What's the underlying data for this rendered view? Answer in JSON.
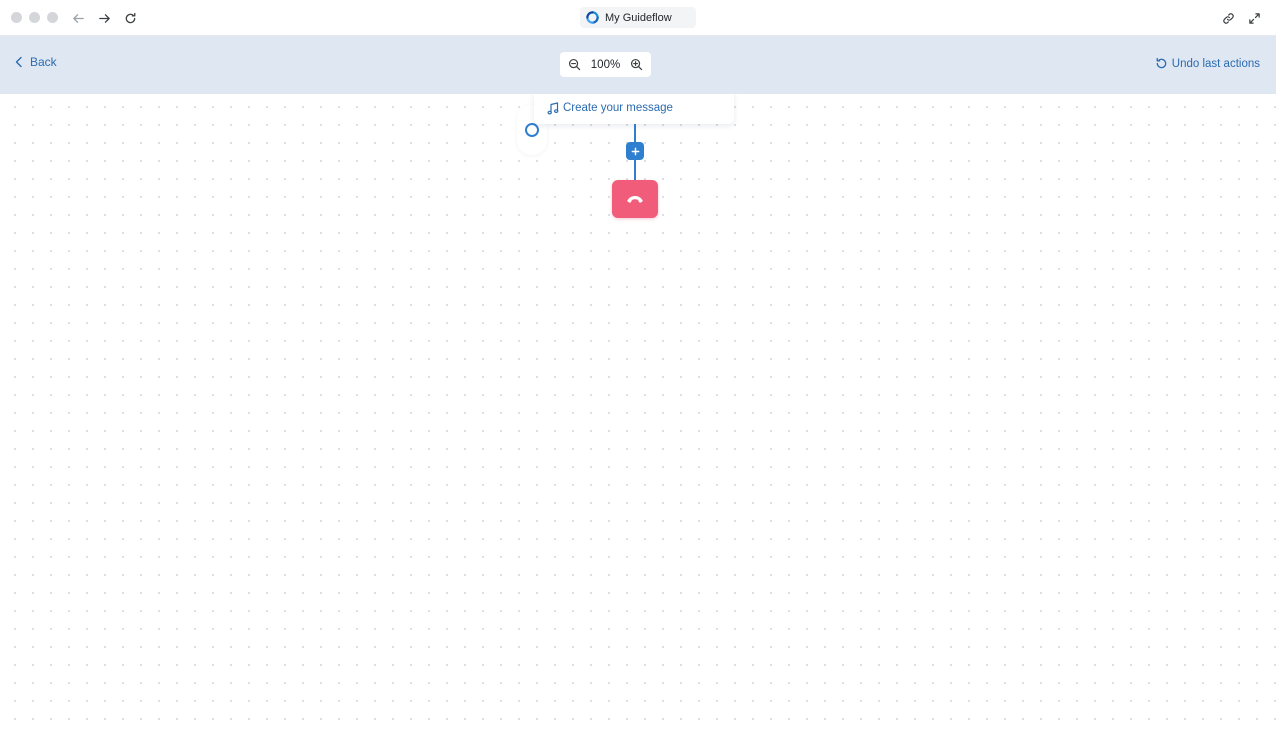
{
  "browser": {
    "tab_title": "My Guideflow",
    "icons": {
      "back": "arrow-left-icon",
      "forward": "arrow-right-icon",
      "reload": "reload-icon",
      "link": "link-icon",
      "expand": "expand-icon"
    }
  },
  "toolbar": {
    "back_label": "Back",
    "zoom_level": "100%",
    "undo_label": "Undo last actions"
  },
  "flow": {
    "message_node_label": "Create your message",
    "end_node": "hang-up-icon"
  },
  "colors": {
    "accent": "#2f7fd0",
    "toolbar_bg": "#dfe7f2",
    "end_node": "#f25c7b"
  }
}
